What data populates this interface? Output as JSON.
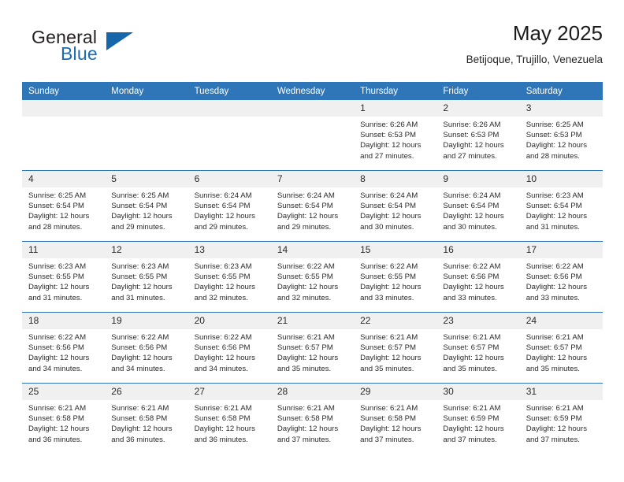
{
  "brand": {
    "word1": "General",
    "word2": "Blue",
    "flag_icon": "flag-triangle-icon",
    "accent_color": "#1566ab"
  },
  "header": {
    "month_title": "May 2025",
    "location": "Betijoque, Trujillo, Venezuela",
    "header_bg_color": "#2e76b8",
    "daynum_bg_color": "#f0f0f0"
  },
  "calendar": {
    "weekday_headers": [
      "Sunday",
      "Monday",
      "Tuesday",
      "Wednesday",
      "Thursday",
      "Friday",
      "Saturday"
    ],
    "weeks": [
      [
        {
          "day": "",
          "empty": true
        },
        {
          "day": "",
          "empty": true
        },
        {
          "day": "",
          "empty": true
        },
        {
          "day": "",
          "empty": true
        },
        {
          "day": "1",
          "sunrise": "Sunrise: 6:26 AM",
          "sunset": "Sunset: 6:53 PM",
          "daylight": "Daylight: 12 hours and 27 minutes."
        },
        {
          "day": "2",
          "sunrise": "Sunrise: 6:26 AM",
          "sunset": "Sunset: 6:53 PM",
          "daylight": "Daylight: 12 hours and 27 minutes."
        },
        {
          "day": "3",
          "sunrise": "Sunrise: 6:25 AM",
          "sunset": "Sunset: 6:53 PM",
          "daylight": "Daylight: 12 hours and 28 minutes."
        }
      ],
      [
        {
          "day": "4",
          "sunrise": "Sunrise: 6:25 AM",
          "sunset": "Sunset: 6:54 PM",
          "daylight": "Daylight: 12 hours and 28 minutes."
        },
        {
          "day": "5",
          "sunrise": "Sunrise: 6:25 AM",
          "sunset": "Sunset: 6:54 PM",
          "daylight": "Daylight: 12 hours and 29 minutes."
        },
        {
          "day": "6",
          "sunrise": "Sunrise: 6:24 AM",
          "sunset": "Sunset: 6:54 PM",
          "daylight": "Daylight: 12 hours and 29 minutes."
        },
        {
          "day": "7",
          "sunrise": "Sunrise: 6:24 AM",
          "sunset": "Sunset: 6:54 PM",
          "daylight": "Daylight: 12 hours and 29 minutes."
        },
        {
          "day": "8",
          "sunrise": "Sunrise: 6:24 AM",
          "sunset": "Sunset: 6:54 PM",
          "daylight": "Daylight: 12 hours and 30 minutes."
        },
        {
          "day": "9",
          "sunrise": "Sunrise: 6:24 AM",
          "sunset": "Sunset: 6:54 PM",
          "daylight": "Daylight: 12 hours and 30 minutes."
        },
        {
          "day": "10",
          "sunrise": "Sunrise: 6:23 AM",
          "sunset": "Sunset: 6:54 PM",
          "daylight": "Daylight: 12 hours and 31 minutes."
        }
      ],
      [
        {
          "day": "11",
          "sunrise": "Sunrise: 6:23 AM",
          "sunset": "Sunset: 6:55 PM",
          "daylight": "Daylight: 12 hours and 31 minutes."
        },
        {
          "day": "12",
          "sunrise": "Sunrise: 6:23 AM",
          "sunset": "Sunset: 6:55 PM",
          "daylight": "Daylight: 12 hours and 31 minutes."
        },
        {
          "day": "13",
          "sunrise": "Sunrise: 6:23 AM",
          "sunset": "Sunset: 6:55 PM",
          "daylight": "Daylight: 12 hours and 32 minutes."
        },
        {
          "day": "14",
          "sunrise": "Sunrise: 6:22 AM",
          "sunset": "Sunset: 6:55 PM",
          "daylight": "Daylight: 12 hours and 32 minutes."
        },
        {
          "day": "15",
          "sunrise": "Sunrise: 6:22 AM",
          "sunset": "Sunset: 6:55 PM",
          "daylight": "Daylight: 12 hours and 33 minutes."
        },
        {
          "day": "16",
          "sunrise": "Sunrise: 6:22 AM",
          "sunset": "Sunset: 6:56 PM",
          "daylight": "Daylight: 12 hours and 33 minutes."
        },
        {
          "day": "17",
          "sunrise": "Sunrise: 6:22 AM",
          "sunset": "Sunset: 6:56 PM",
          "daylight": "Daylight: 12 hours and 33 minutes."
        }
      ],
      [
        {
          "day": "18",
          "sunrise": "Sunrise: 6:22 AM",
          "sunset": "Sunset: 6:56 PM",
          "daylight": "Daylight: 12 hours and 34 minutes."
        },
        {
          "day": "19",
          "sunrise": "Sunrise: 6:22 AM",
          "sunset": "Sunset: 6:56 PM",
          "daylight": "Daylight: 12 hours and 34 minutes."
        },
        {
          "day": "20",
          "sunrise": "Sunrise: 6:22 AM",
          "sunset": "Sunset: 6:56 PM",
          "daylight": "Daylight: 12 hours and 34 minutes."
        },
        {
          "day": "21",
          "sunrise": "Sunrise: 6:21 AM",
          "sunset": "Sunset: 6:57 PM",
          "daylight": "Daylight: 12 hours and 35 minutes."
        },
        {
          "day": "22",
          "sunrise": "Sunrise: 6:21 AM",
          "sunset": "Sunset: 6:57 PM",
          "daylight": "Daylight: 12 hours and 35 minutes."
        },
        {
          "day": "23",
          "sunrise": "Sunrise: 6:21 AM",
          "sunset": "Sunset: 6:57 PM",
          "daylight": "Daylight: 12 hours and 35 minutes."
        },
        {
          "day": "24",
          "sunrise": "Sunrise: 6:21 AM",
          "sunset": "Sunset: 6:57 PM",
          "daylight": "Daylight: 12 hours and 35 minutes."
        }
      ],
      [
        {
          "day": "25",
          "sunrise": "Sunrise: 6:21 AM",
          "sunset": "Sunset: 6:58 PM",
          "daylight": "Daylight: 12 hours and 36 minutes."
        },
        {
          "day": "26",
          "sunrise": "Sunrise: 6:21 AM",
          "sunset": "Sunset: 6:58 PM",
          "daylight": "Daylight: 12 hours and 36 minutes."
        },
        {
          "day": "27",
          "sunrise": "Sunrise: 6:21 AM",
          "sunset": "Sunset: 6:58 PM",
          "daylight": "Daylight: 12 hours and 36 minutes."
        },
        {
          "day": "28",
          "sunrise": "Sunrise: 6:21 AM",
          "sunset": "Sunset: 6:58 PM",
          "daylight": "Daylight: 12 hours and 37 minutes."
        },
        {
          "day": "29",
          "sunrise": "Sunrise: 6:21 AM",
          "sunset": "Sunset: 6:58 PM",
          "daylight": "Daylight: 12 hours and 37 minutes."
        },
        {
          "day": "30",
          "sunrise": "Sunrise: 6:21 AM",
          "sunset": "Sunset: 6:59 PM",
          "daylight": "Daylight: 12 hours and 37 minutes."
        },
        {
          "day": "31",
          "sunrise": "Sunrise: 6:21 AM",
          "sunset": "Sunset: 6:59 PM",
          "daylight": "Daylight: 12 hours and 37 minutes."
        }
      ]
    ]
  }
}
